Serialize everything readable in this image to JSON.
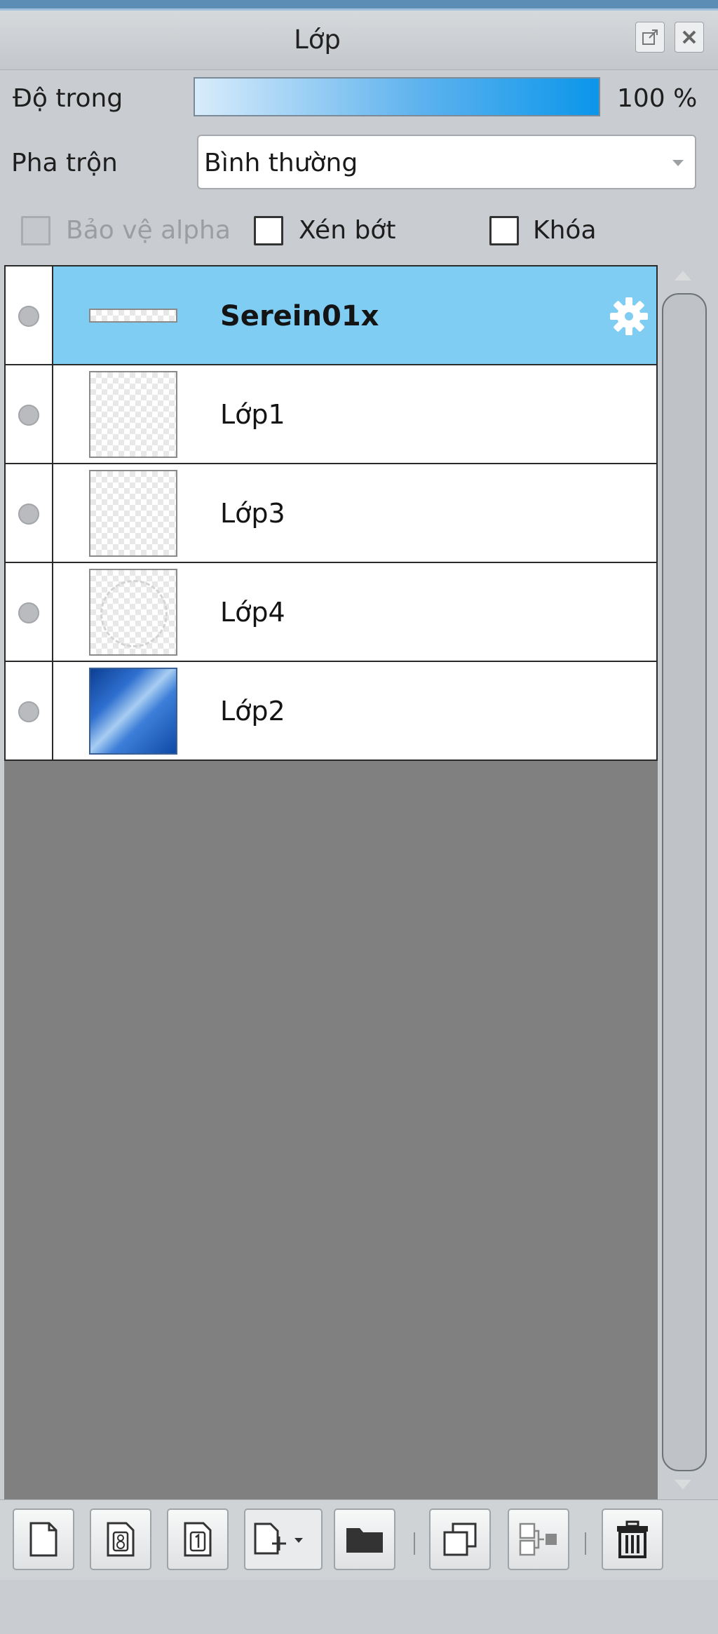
{
  "panel": {
    "title": "Lớp"
  },
  "opacity": {
    "label": "Độ trong",
    "value_text": "100 %",
    "fraction": 1.0
  },
  "blend": {
    "label": "Pha trộn",
    "selected": "Bình thường"
  },
  "options": {
    "alpha_protect": {
      "label": "Bảo vệ alpha",
      "checked": false,
      "disabled": true
    },
    "clip": {
      "label": "Xén bớt",
      "checked": false
    },
    "lock": {
      "label": "Khóa",
      "checked": false
    }
  },
  "layers": [
    {
      "name": "Serein01x",
      "selected": true,
      "thumb": "strip",
      "icon": "gear-icon"
    },
    {
      "name": "Lớp1",
      "selected": false,
      "thumb": "transparent"
    },
    {
      "name": "Lớp3",
      "selected": false,
      "thumb": "transparent"
    },
    {
      "name": "Lớp4",
      "selected": false,
      "thumb": "ring"
    },
    {
      "name": "Lớp2",
      "selected": false,
      "thumb": "sky"
    }
  ],
  "toolbar_icons": [
    "new-layer-icon",
    "new-8bit-layer-icon",
    "new-1bit-layer-icon",
    "add-layer-dropdown-icon",
    "new-folder-icon",
    "duplicate-layer-icon",
    "merge-layer-icon",
    "delete-layer-icon"
  ],
  "colors": {
    "selected_row": "#80cdf3",
    "list_background": "#808080",
    "opacity_fill": "#0b96ea"
  }
}
